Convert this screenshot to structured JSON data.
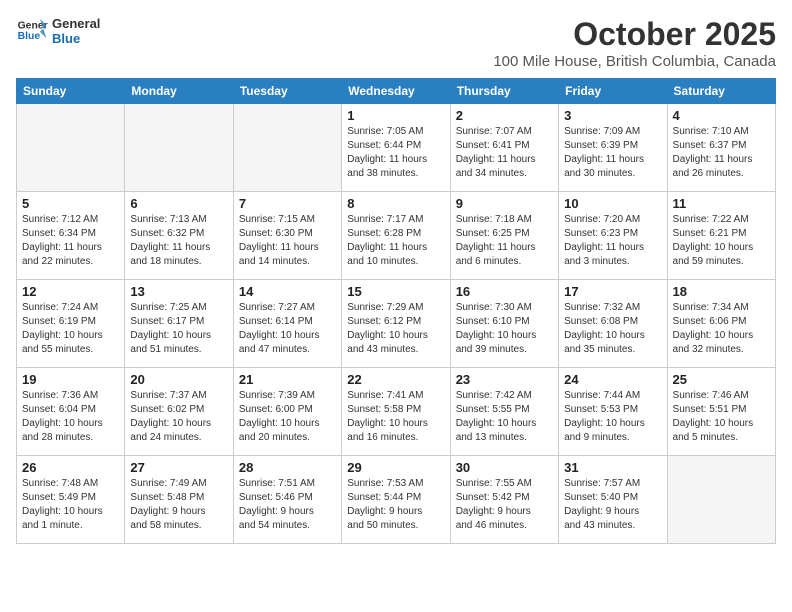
{
  "header": {
    "logo_line1": "General",
    "logo_line2": "Blue",
    "month": "October 2025",
    "location": "100 Mile House, British Columbia, Canada"
  },
  "weekdays": [
    "Sunday",
    "Monday",
    "Tuesday",
    "Wednesday",
    "Thursday",
    "Friday",
    "Saturday"
  ],
  "weeks": [
    [
      {
        "day": "",
        "info": ""
      },
      {
        "day": "",
        "info": ""
      },
      {
        "day": "",
        "info": ""
      },
      {
        "day": "1",
        "info": "Sunrise: 7:05 AM\nSunset: 6:44 PM\nDaylight: 11 hours\nand 38 minutes."
      },
      {
        "day": "2",
        "info": "Sunrise: 7:07 AM\nSunset: 6:41 PM\nDaylight: 11 hours\nand 34 minutes."
      },
      {
        "day": "3",
        "info": "Sunrise: 7:09 AM\nSunset: 6:39 PM\nDaylight: 11 hours\nand 30 minutes."
      },
      {
        "day": "4",
        "info": "Sunrise: 7:10 AM\nSunset: 6:37 PM\nDaylight: 11 hours\nand 26 minutes."
      }
    ],
    [
      {
        "day": "5",
        "info": "Sunrise: 7:12 AM\nSunset: 6:34 PM\nDaylight: 11 hours\nand 22 minutes."
      },
      {
        "day": "6",
        "info": "Sunrise: 7:13 AM\nSunset: 6:32 PM\nDaylight: 11 hours\nand 18 minutes."
      },
      {
        "day": "7",
        "info": "Sunrise: 7:15 AM\nSunset: 6:30 PM\nDaylight: 11 hours\nand 14 minutes."
      },
      {
        "day": "8",
        "info": "Sunrise: 7:17 AM\nSunset: 6:28 PM\nDaylight: 11 hours\nand 10 minutes."
      },
      {
        "day": "9",
        "info": "Sunrise: 7:18 AM\nSunset: 6:25 PM\nDaylight: 11 hours\nand 6 minutes."
      },
      {
        "day": "10",
        "info": "Sunrise: 7:20 AM\nSunset: 6:23 PM\nDaylight: 11 hours\nand 3 minutes."
      },
      {
        "day": "11",
        "info": "Sunrise: 7:22 AM\nSunset: 6:21 PM\nDaylight: 10 hours\nand 59 minutes."
      }
    ],
    [
      {
        "day": "12",
        "info": "Sunrise: 7:24 AM\nSunset: 6:19 PM\nDaylight: 10 hours\nand 55 minutes."
      },
      {
        "day": "13",
        "info": "Sunrise: 7:25 AM\nSunset: 6:17 PM\nDaylight: 10 hours\nand 51 minutes."
      },
      {
        "day": "14",
        "info": "Sunrise: 7:27 AM\nSunset: 6:14 PM\nDaylight: 10 hours\nand 47 minutes."
      },
      {
        "day": "15",
        "info": "Sunrise: 7:29 AM\nSunset: 6:12 PM\nDaylight: 10 hours\nand 43 minutes."
      },
      {
        "day": "16",
        "info": "Sunrise: 7:30 AM\nSunset: 6:10 PM\nDaylight: 10 hours\nand 39 minutes."
      },
      {
        "day": "17",
        "info": "Sunrise: 7:32 AM\nSunset: 6:08 PM\nDaylight: 10 hours\nand 35 minutes."
      },
      {
        "day": "18",
        "info": "Sunrise: 7:34 AM\nSunset: 6:06 PM\nDaylight: 10 hours\nand 32 minutes."
      }
    ],
    [
      {
        "day": "19",
        "info": "Sunrise: 7:36 AM\nSunset: 6:04 PM\nDaylight: 10 hours\nand 28 minutes."
      },
      {
        "day": "20",
        "info": "Sunrise: 7:37 AM\nSunset: 6:02 PM\nDaylight: 10 hours\nand 24 minutes."
      },
      {
        "day": "21",
        "info": "Sunrise: 7:39 AM\nSunset: 6:00 PM\nDaylight: 10 hours\nand 20 minutes."
      },
      {
        "day": "22",
        "info": "Sunrise: 7:41 AM\nSunset: 5:58 PM\nDaylight: 10 hours\nand 16 minutes."
      },
      {
        "day": "23",
        "info": "Sunrise: 7:42 AM\nSunset: 5:55 PM\nDaylight: 10 hours\nand 13 minutes."
      },
      {
        "day": "24",
        "info": "Sunrise: 7:44 AM\nSunset: 5:53 PM\nDaylight: 10 hours\nand 9 minutes."
      },
      {
        "day": "25",
        "info": "Sunrise: 7:46 AM\nSunset: 5:51 PM\nDaylight: 10 hours\nand 5 minutes."
      }
    ],
    [
      {
        "day": "26",
        "info": "Sunrise: 7:48 AM\nSunset: 5:49 PM\nDaylight: 10 hours\nand 1 minute."
      },
      {
        "day": "27",
        "info": "Sunrise: 7:49 AM\nSunset: 5:48 PM\nDaylight: 9 hours\nand 58 minutes."
      },
      {
        "day": "28",
        "info": "Sunrise: 7:51 AM\nSunset: 5:46 PM\nDaylight: 9 hours\nand 54 minutes."
      },
      {
        "day": "29",
        "info": "Sunrise: 7:53 AM\nSunset: 5:44 PM\nDaylight: 9 hours\nand 50 minutes."
      },
      {
        "day": "30",
        "info": "Sunrise: 7:55 AM\nSunset: 5:42 PM\nDaylight: 9 hours\nand 46 minutes."
      },
      {
        "day": "31",
        "info": "Sunrise: 7:57 AM\nSunset: 5:40 PM\nDaylight: 9 hours\nand 43 minutes."
      },
      {
        "day": "",
        "info": ""
      }
    ]
  ]
}
